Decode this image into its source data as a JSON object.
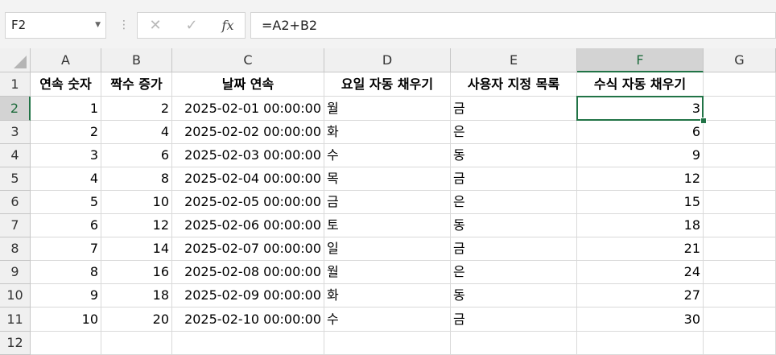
{
  "formula_bar": {
    "name_box": "F2",
    "cancel_icon": "✕",
    "enter_icon": "✓",
    "fx_label": "fx",
    "formula": "=A2+B2"
  },
  "columns": [
    "A",
    "B",
    "C",
    "D",
    "E",
    "F",
    "G"
  ],
  "rows": [
    "1",
    "2",
    "3",
    "4",
    "5",
    "6",
    "7",
    "8",
    "9",
    "10",
    "11",
    "12"
  ],
  "selected_cell": "F2",
  "headers": [
    "연속 숫자",
    "짝수 증가",
    "날짜 연속",
    "요일 자동 채우기",
    "사용자 지정 목록",
    "수식 자동 채우기"
  ],
  "data": [
    [
      "1",
      "2",
      "2025-02-01 00:00:00",
      "월",
      "금",
      "3"
    ],
    [
      "2",
      "4",
      "2025-02-02 00:00:00",
      "화",
      "은",
      "6"
    ],
    [
      "3",
      "6",
      "2025-02-03 00:00:00",
      "수",
      "동",
      "9"
    ],
    [
      "4",
      "8",
      "2025-02-04 00:00:00",
      "목",
      "금",
      "12"
    ],
    [
      "5",
      "10",
      "2025-02-05 00:00:00",
      "금",
      "은",
      "15"
    ],
    [
      "6",
      "12",
      "2025-02-06 00:00:00",
      "토",
      "동",
      "18"
    ],
    [
      "7",
      "14",
      "2025-02-07 00:00:00",
      "일",
      "금",
      "21"
    ],
    [
      "8",
      "16",
      "2025-02-08 00:00:00",
      "월",
      "은",
      "24"
    ],
    [
      "9",
      "18",
      "2025-02-09 00:00:00",
      "화",
      "동",
      "27"
    ],
    [
      "10",
      "20",
      "2025-02-10 00:00:00",
      "수",
      "금",
      "30"
    ]
  ],
  "colors": {
    "accent": "#217346",
    "grid": "#d9d9d9",
    "header_bg": "#f0f0f0",
    "selected_header_bg": "#d3d3d3"
  }
}
